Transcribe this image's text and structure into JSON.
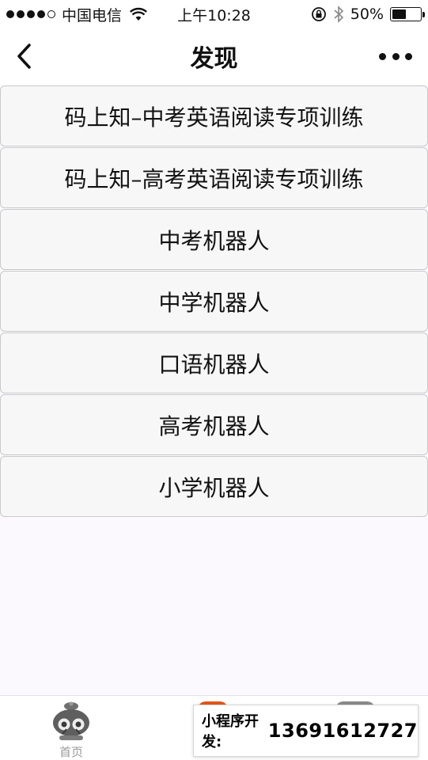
{
  "status_bar": {
    "carrier": "中国电信",
    "time": "上午10:28",
    "battery_text": "50%",
    "battery_level": 0.5,
    "icons": [
      "signal-dots-icon",
      "wifi-icon",
      "rotation-lock-icon",
      "bluetooth-icon",
      "battery-icon"
    ]
  },
  "nav": {
    "title": "发现",
    "back_icon": "chevron-left-icon",
    "more_icon": "more-dots-icon"
  },
  "list": {
    "items": [
      "码上知–中考英语阅读专项训练",
      "码上知–高考英语阅读专项训练",
      "中考机器人",
      "中学机器人",
      "口语机器人",
      "高考机器人",
      "小学机器人"
    ]
  },
  "tab_bar": {
    "tabs": [
      {
        "label": "首页",
        "icon": "robot-mascot-icon"
      },
      {
        "label": "",
        "icon": "orange-tab-icon"
      },
      {
        "label": "",
        "icon": "gray-tab-icon"
      }
    ]
  },
  "dev_badge": {
    "label": "小程序开发:",
    "phone": "13691612727"
  },
  "colors": {
    "background": "#fbf9fe",
    "list_item_bg": "#f7f7f7",
    "list_item_border": "#c9c9c9",
    "tab_label": "#9a9a9a",
    "accent_orange": "#e2561a"
  }
}
